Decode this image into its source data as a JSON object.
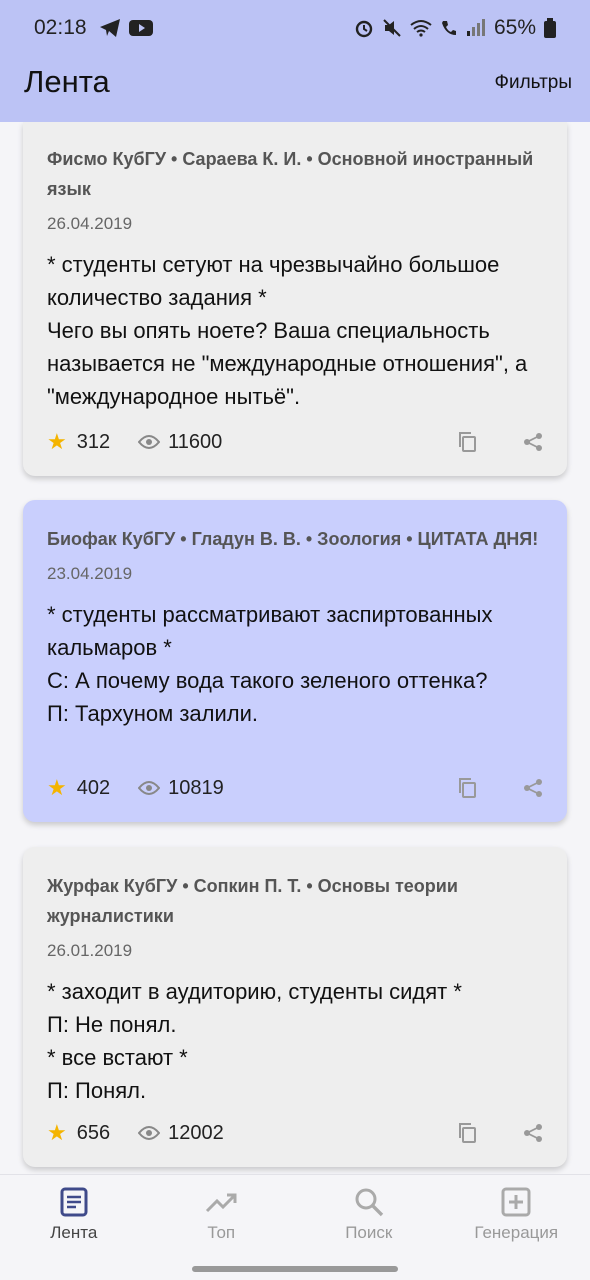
{
  "status_bar": {
    "time": "02:18",
    "battery": "65%"
  },
  "app_bar": {
    "title": "Лента",
    "filters": "Фильтры"
  },
  "cards": [
    {
      "meta": "Фисмо КубГУ • Сараева К. И. • Основной иностранный язык",
      "date": "26.04.2019",
      "text": "* студенты сетуют на чрезвычайно большое количество задания *\nЧего вы опять ноете? Ваша специальность называется не \"международные отношения\", а \"международное нытьё\".",
      "rating": "312",
      "views": "11600",
      "highlight": false
    },
    {
      "meta": "Биофак КубГУ • Гладун В. В. • Зоология • ЦИТАТА ДНЯ!",
      "date": "23.04.2019",
      "text": "* студенты рассматривают заспиртованных кальмаров *\nС: А почему вода такого зеленого оттенка?\nП: Тархуном залили.",
      "rating": "402",
      "views": "10819",
      "highlight": true
    },
    {
      "meta": "Журфак КубГУ • Сопкин П. Т. • Основы теории журналистики",
      "date": "26.01.2019",
      "text": "* заходит в аудиторию, студенты сидят *\nП: Не понял.\n* все встают *\nП: Понял.",
      "rating": "656",
      "views": "12002",
      "highlight": false
    }
  ],
  "bottom_nav": [
    {
      "label": "Лента",
      "icon": "feed-icon",
      "active": true
    },
    {
      "label": "Топ",
      "icon": "trending-icon",
      "active": false
    },
    {
      "label": "Поиск",
      "icon": "search-icon",
      "active": false
    },
    {
      "label": "Генерация",
      "icon": "add-box-icon",
      "active": false
    }
  ],
  "colors": {
    "app_bar": "#bcc3f5",
    "highlight_card": "#c9cffd",
    "card": "#eeeeee",
    "star": "#f4b400"
  }
}
